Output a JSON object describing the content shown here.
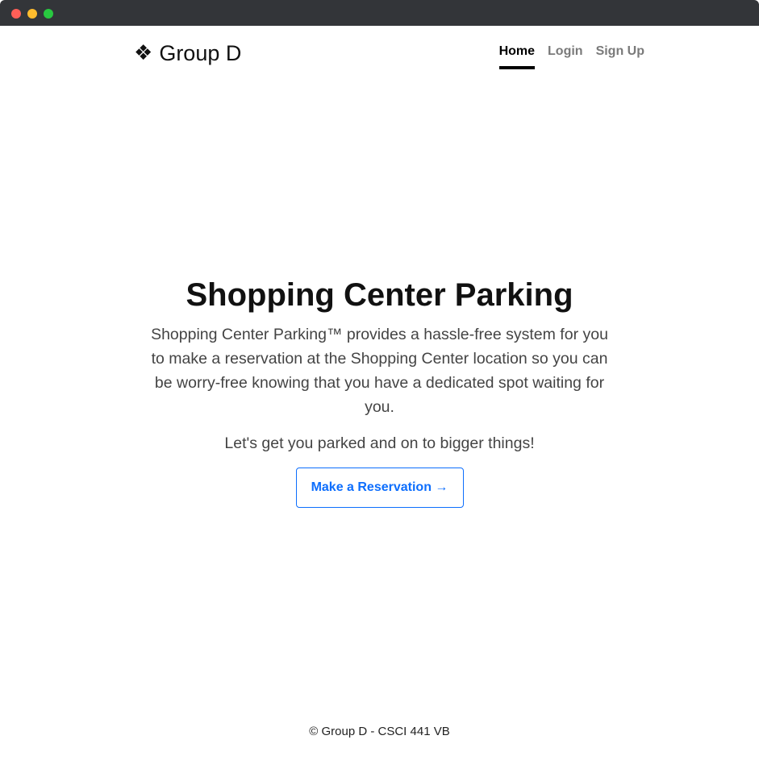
{
  "brand": {
    "icon": "❖",
    "icon_name": "diamond-icon",
    "name": "Group D"
  },
  "nav": {
    "items": [
      {
        "label": "Home",
        "active": true
      },
      {
        "label": "Login",
        "active": false
      },
      {
        "label": "Sign Up",
        "active": false
      }
    ]
  },
  "hero": {
    "title": "Shopping Center Parking",
    "lead": "Shopping Center Parking™ provides a hassle-free system for you to make a reservation at the Shopping Center location so you can be worry-free knowing that you have a dedicated spot waiting for you.",
    "subtext": "Let's get you parked and on to bigger things!",
    "cta_label": "Make a Reservation →"
  },
  "footer": {
    "text": "© Group D - CSCI 441 VB"
  },
  "colors": {
    "accent": "#0d6efd",
    "titlebar": "#333539",
    "nav_inactive": "#7a7a7a"
  }
}
